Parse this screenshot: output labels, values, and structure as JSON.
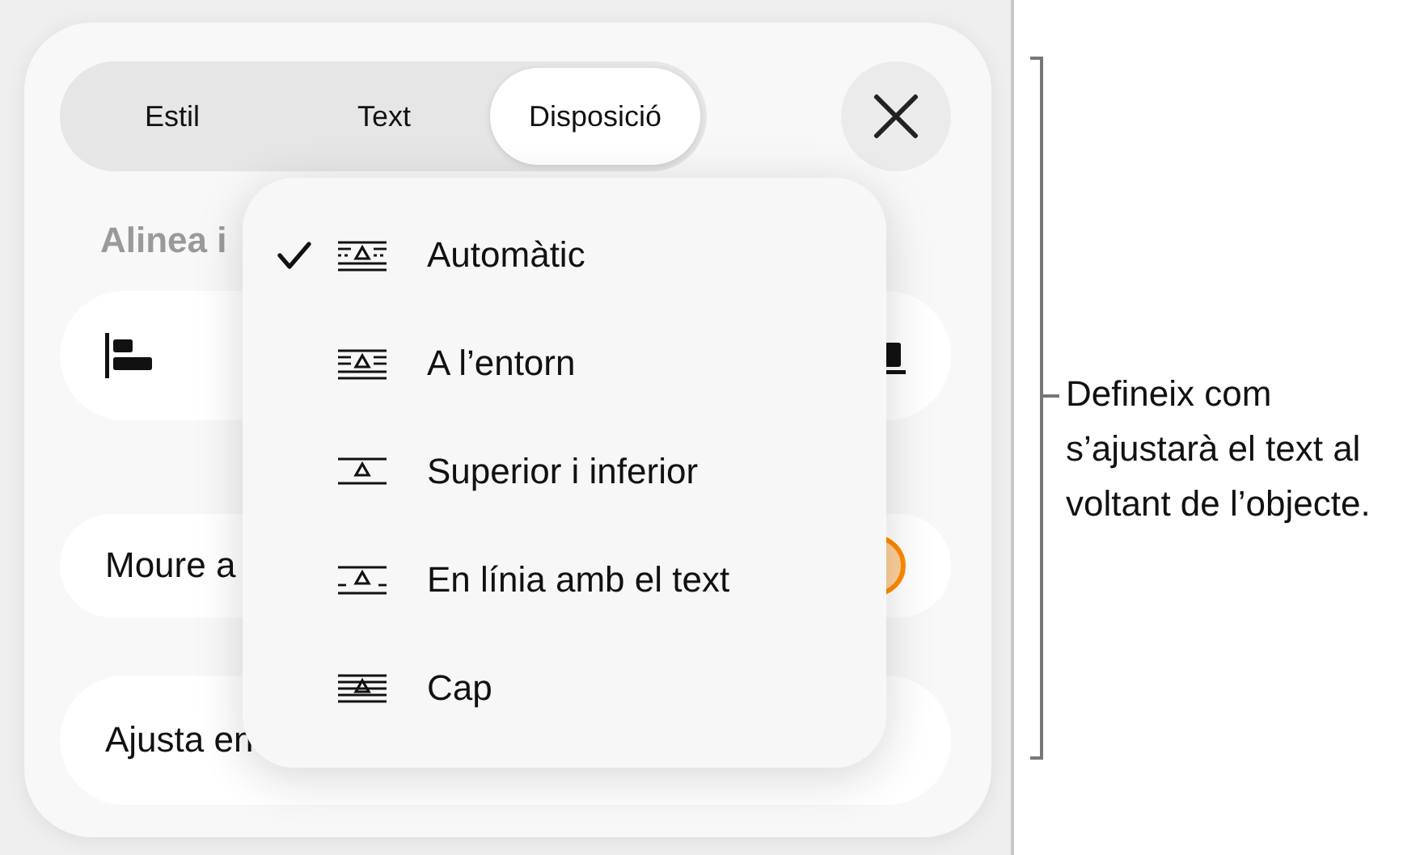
{
  "tabs": [
    {
      "label": "Estil",
      "selected": false
    },
    {
      "label": "Text",
      "selected": false
    },
    {
      "label": "Disposició",
      "selected": true
    }
  ],
  "section_heading": "Alinea i",
  "rows": [
    {
      "kind": "align"
    },
    {
      "kind": "toggle",
      "label": "Moure a",
      "on": true
    },
    {
      "kind": "plain",
      "label": "Ajusta en"
    }
  ],
  "wrap_menu": [
    {
      "label": "Automàtic",
      "kind": "auto",
      "checked": true
    },
    {
      "label": "A l’entorn",
      "kind": "around",
      "checked": false
    },
    {
      "label": "Superior i inferior",
      "kind": "top_bottom",
      "checked": false
    },
    {
      "label": "En línia amb el text",
      "kind": "inline",
      "checked": false
    },
    {
      "label": "Cap",
      "kind": "none",
      "checked": false
    }
  ],
  "callout": "Defineix com s’ajustarà el text al voltant de l’objecte."
}
